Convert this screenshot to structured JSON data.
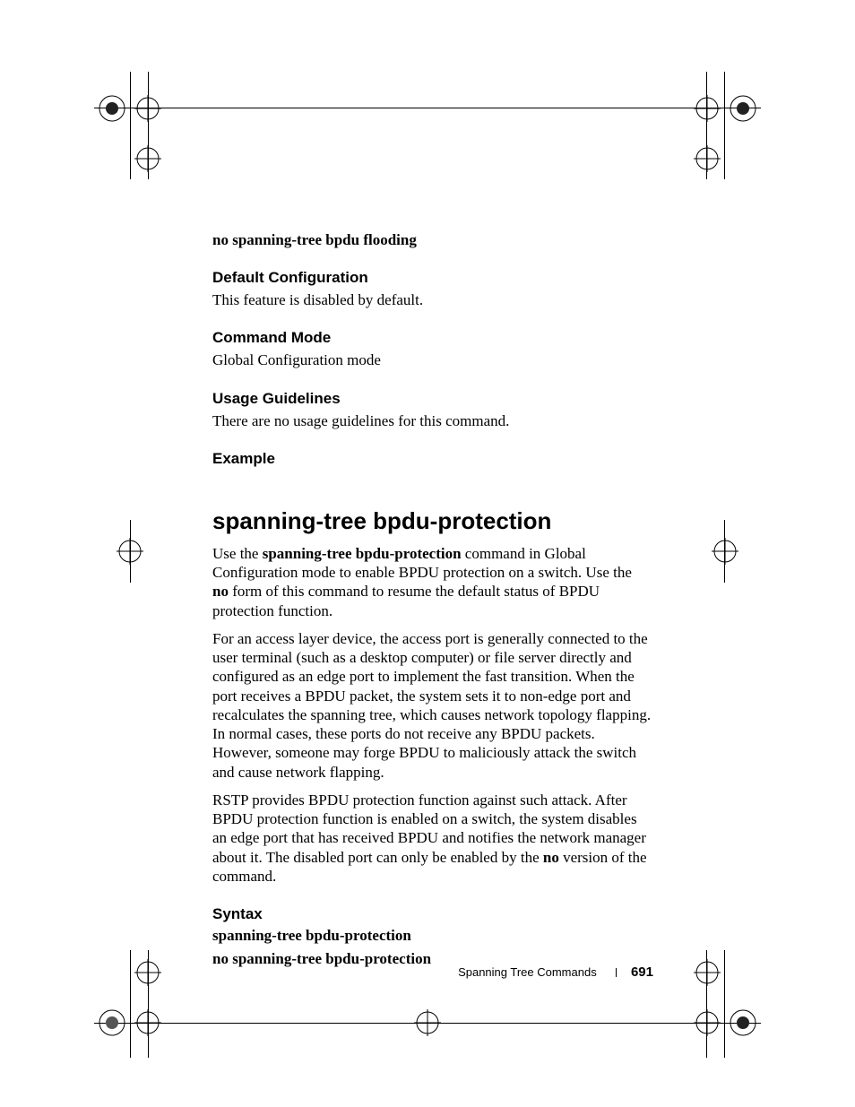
{
  "syntax_no_flooding": "no spanning-tree bpdu flooding",
  "sec_default_head": "Default Configuration",
  "sec_default_body": "This feature is disabled by default.",
  "sec_mode_head": "Command Mode",
  "sec_mode_body": "Global Configuration mode",
  "sec_usage_head": "Usage Guidelines",
  "sec_usage_body": "There are no usage guidelines for this command.",
  "sec_example_head": "Example",
  "topic_head": "spanning-tree bpdu-protection",
  "p1_a": "Use the ",
  "p1_b": "spanning-tree bpdu-protection",
  "p1_c": " command in Global Configuration mode to enable BPDU protection on a switch. Use the ",
  "p1_d": "no",
  "p1_e": " form of this command to resume the default status of BPDU protection function.",
  "p2": "For an access layer device, the access port is generally connected to the user terminal (such as a desktop computer) or file server directly and configured as an edge port to implement the fast transition. When the port receives a BPDU packet, the system sets it to non-edge port and recalculates the spanning tree, which causes network topology flapping. In normal cases, these ports do not receive any BPDU packets. However, someone may forge BPDU to maliciously attack the switch and cause network flapping.",
  "p3_a": "RSTP provides BPDU protection function against such attack. After BPDU protection function is enabled on a switch, the system disables an edge port that has received BPDU and notifies the network manager about it. The disabled port can only be enabled by the ",
  "p3_b": "no",
  "p3_c": " version of the command.",
  "sec_syntax_head": "Syntax",
  "syntax_on": "spanning-tree bpdu-protection",
  "syntax_off": "no spanning-tree bpdu-protection",
  "footer_title": "Spanning Tree Commands",
  "footer_page": "691"
}
